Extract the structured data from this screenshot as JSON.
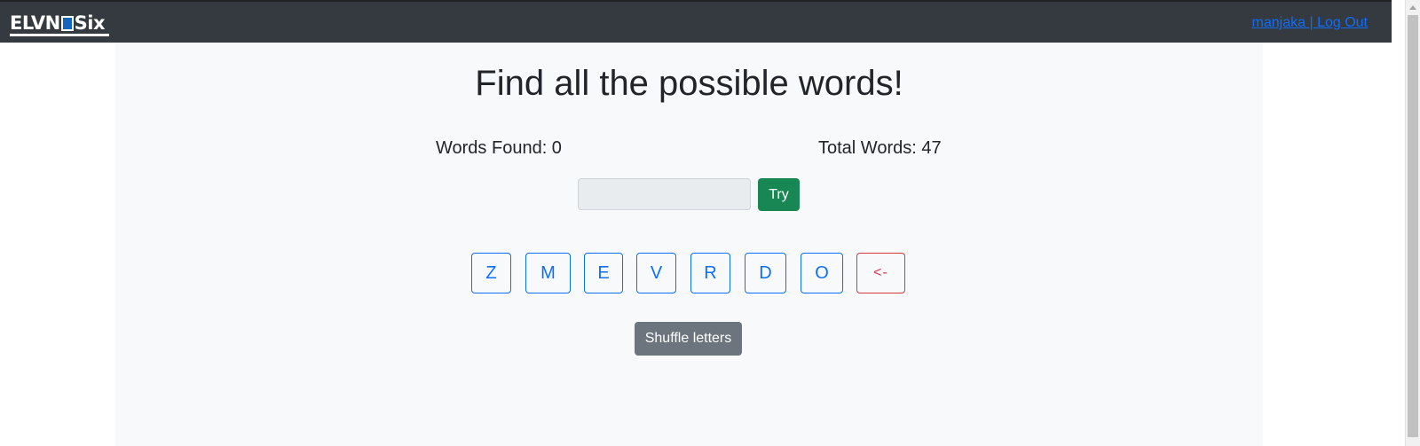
{
  "navbar": {
    "logo_text_left": "ELVN",
    "logo_text_right": "Six",
    "username": "manjaka",
    "separator": " | ",
    "logout_label": "Log Out"
  },
  "main": {
    "title": "Find all the possible words!",
    "words_found_label": "Words Found: 0",
    "total_words_label": "Total Words: 47",
    "try_label": "Try",
    "letters": [
      "Z",
      "M",
      "E",
      "V",
      "R",
      "D",
      "O"
    ],
    "backspace_label": "<-",
    "shuffle_label": "Shuffle letters"
  },
  "colors": {
    "navbar_bg": "#343a40",
    "primary": "#0d6efd",
    "success": "#198754",
    "danger": "#dc3545",
    "secondary": "#6c757d"
  }
}
